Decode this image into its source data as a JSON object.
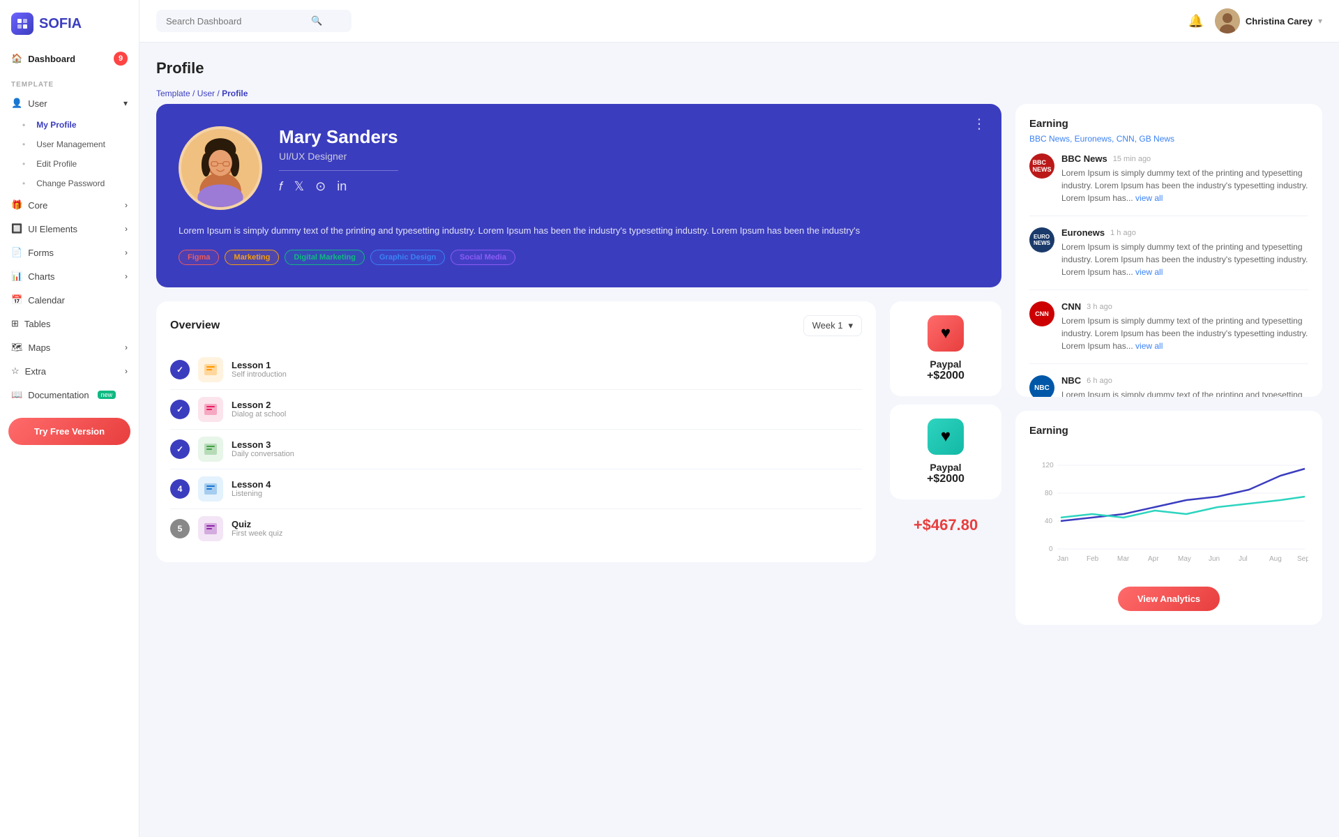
{
  "app": {
    "name": "SOFIA"
  },
  "sidebar": {
    "dashboard_label": "Dashboard",
    "dashboard_badge": "9",
    "section_label": "TEMPLATE",
    "items": [
      {
        "id": "user",
        "label": "User",
        "has_arrow": true
      },
      {
        "id": "my-profile",
        "label": "My Profile",
        "active": true
      },
      {
        "id": "user-management",
        "label": "User Management"
      },
      {
        "id": "edit-profile",
        "label": "Edit Profile"
      },
      {
        "id": "change-password",
        "label": "Change Password"
      },
      {
        "id": "core",
        "label": "Core",
        "has_arrow": true
      },
      {
        "id": "ui-elements",
        "label": "UI Elements",
        "has_arrow": true
      },
      {
        "id": "forms",
        "label": "Forms",
        "has_arrow": true
      },
      {
        "id": "charts",
        "label": "Charts",
        "has_arrow": true
      },
      {
        "id": "calendar",
        "label": "Calendar"
      },
      {
        "id": "tables",
        "label": "Tables"
      },
      {
        "id": "maps",
        "label": "Maps",
        "has_arrow": true
      },
      {
        "id": "extra",
        "label": "Extra",
        "has_arrow": true
      },
      {
        "id": "documentation",
        "label": "Documentation",
        "badge": "new"
      }
    ],
    "try_free": "Try Free Version"
  },
  "header": {
    "search_placeholder": "Search Dashboard",
    "user_name": "Christina Carey"
  },
  "breadcrumb": {
    "parts": [
      "Template",
      "User",
      "Profile"
    ],
    "active": "Profile"
  },
  "page_title": "Profile",
  "profile": {
    "name": "Mary Sanders",
    "role": "UI/UX Designer",
    "bio": "Lorem Ipsum is simply dummy text of the printing and typesetting industry. Lorem Ipsum has been the industry's typesetting industry. Lorem Ipsum has been the industry's",
    "tags": [
      {
        "label": "Figma",
        "class": "figma"
      },
      {
        "label": "Marketing",
        "class": "marketing"
      },
      {
        "label": "Digital Marketing",
        "class": "digital"
      },
      {
        "label": "Graphic Design",
        "class": "graphic"
      },
      {
        "label": "Social Media",
        "class": "social"
      }
    ]
  },
  "overview": {
    "title": "Overview",
    "week_select": "Week 1",
    "lessons": [
      {
        "step": "✓",
        "step_class": "done",
        "name": "Lesson 1",
        "sub": "Self introduction",
        "connector": "blue"
      },
      {
        "step": "✓",
        "step_class": "done",
        "name": "Lesson 2",
        "sub": "Dialog at school",
        "connector": "blue"
      },
      {
        "step": "✓",
        "step_class": "done",
        "name": "Lesson 3",
        "sub": "Daily conversation",
        "connector": "blue"
      },
      {
        "step": "4",
        "step_class": "active",
        "name": "Lesson 4",
        "sub": "Listening",
        "connector": "gray"
      },
      {
        "step": "5",
        "step_class": "quiz",
        "name": "Quiz",
        "sub": "First week quiz",
        "connector": ""
      }
    ]
  },
  "paypal": [
    {
      "icon": "♥",
      "icon_class": "red",
      "name": "Paypal",
      "amount": "+$2000"
    },
    {
      "icon": "♥",
      "icon_class": "teal",
      "name": "Paypal",
      "amount": "+$2000"
    }
  ],
  "total": "+$467.80",
  "earning_news": {
    "title": "Earning",
    "sources": "BBC News, Euronews, CNN, GB News",
    "items": [
      {
        "logo_class": "bbc",
        "logo_text": "BBC",
        "name": "BBC News",
        "time": "15 min ago",
        "body": "Lorem Ipsum is simply dummy text of the printing and typesetting industry. Lorem Ipsum has been the industry's typesetting industry. Lorem Ipsum has..."
      },
      {
        "logo_class": "euro",
        "logo_text": "EUR",
        "name": "Euronews",
        "time": "1 h ago",
        "body": "Lorem Ipsum is simply dummy text of the printing and typesetting industry. Lorem Ipsum has been the industry's typesetting industry. Lorem Ipsum has..."
      },
      {
        "logo_class": "cnn",
        "logo_text": "CNN",
        "name": "CNN",
        "time": "3 h ago",
        "body": "Lorem Ipsum is simply dummy text of the printing and typesetting industry. Lorem Ipsum has been the industry's typesetting industry. Lorem Ipsum has..."
      },
      {
        "logo_class": "nbc",
        "logo_text": "NBC",
        "name": "NBC",
        "time": "6 h ago",
        "body": "Lorem Ipsum is simply dummy text of the printing and typesetting industry..."
      }
    ],
    "view_all": "view all"
  },
  "chart": {
    "title": "Earning",
    "x_labels": [
      "Jan",
      "Feb",
      "Mar",
      "Apr",
      "May",
      "Jun",
      "Jul",
      "Aug",
      "Sep"
    ],
    "y_labels": [
      "0",
      "40",
      "80",
      "120"
    ],
    "view_analytics": "View Analytics"
  }
}
